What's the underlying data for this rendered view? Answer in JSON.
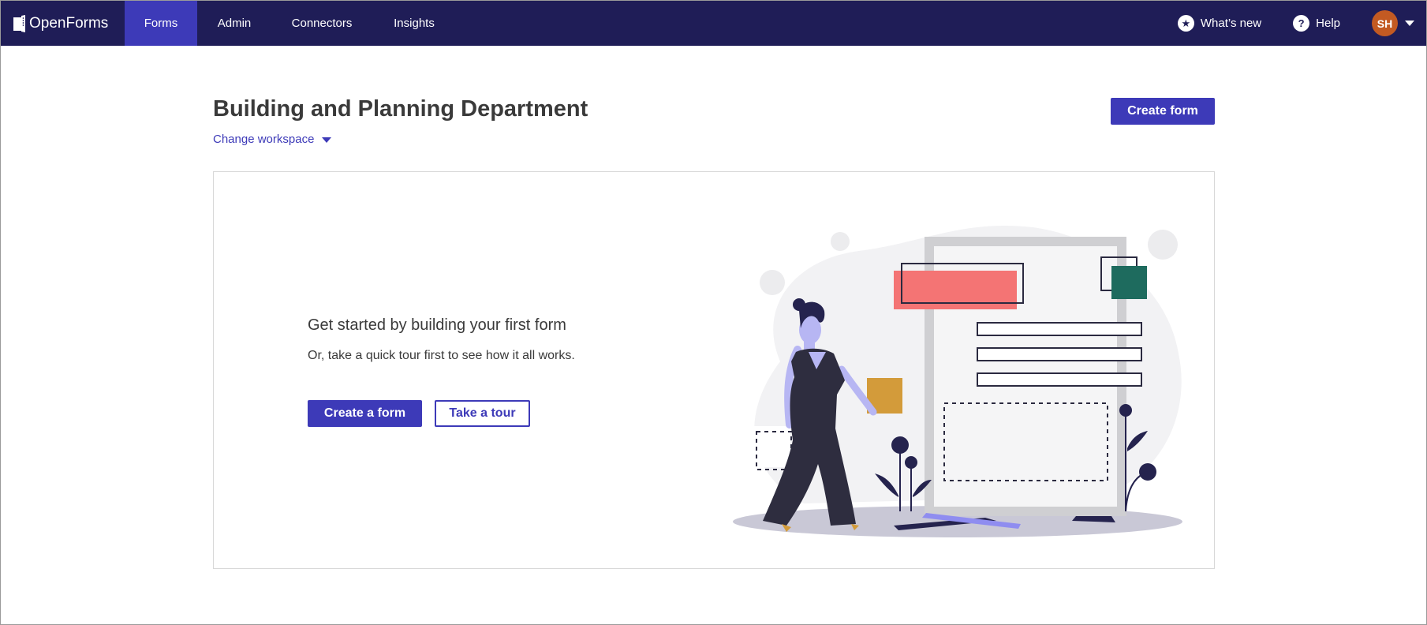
{
  "app": {
    "logo_text": "OpenForms"
  },
  "nav": {
    "items": [
      {
        "label": "Forms",
        "active": true
      },
      {
        "label": "Admin",
        "active": false
      },
      {
        "label": "Connectors",
        "active": false
      },
      {
        "label": "Insights",
        "active": false
      }
    ],
    "whats_new": "What’s new",
    "help": "Help",
    "avatar_initials": "SH"
  },
  "header": {
    "title": "Building and Planning Department",
    "change_workspace": "Change workspace",
    "create_form": "Create form"
  },
  "empty_state": {
    "heading": "Get started by building your first form",
    "subheading": "Or, take a quick tour first to see how it all works.",
    "create_button": "Create a form",
    "tour_button": "Take a tour"
  },
  "colors": {
    "nav_bg": "#1f1d57",
    "nav_active": "#3d3ab8",
    "primary": "#3d3ab8",
    "avatar": "#c35a22",
    "accent_red": "#f47474",
    "accent_green": "#1e6b5e",
    "accent_gold": "#d39b3a"
  },
  "icons": {
    "logo": "openforms-logo-icon",
    "whats_new": "star-icon",
    "help": "question-icon",
    "account_menu": "caret-down-icon",
    "change_workspace": "caret-down-icon"
  }
}
